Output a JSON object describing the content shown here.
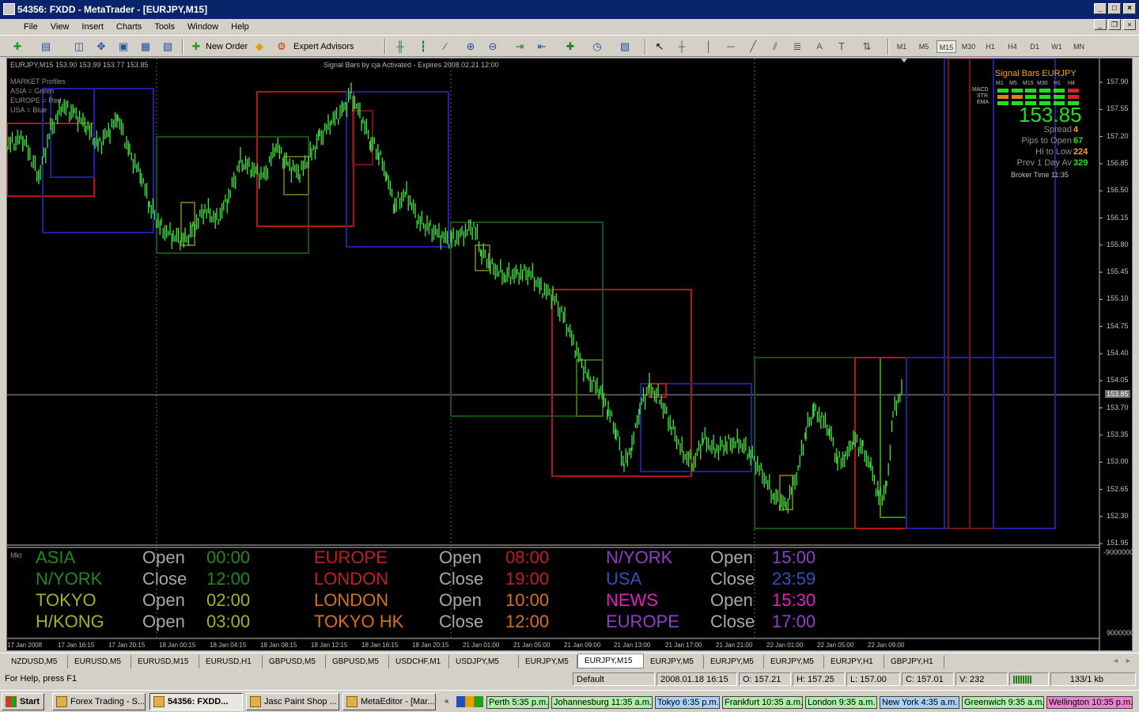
{
  "window": {
    "title": "54356: FXDD - MetaTrader - [EURJPY,M15]"
  },
  "menu": [
    "File",
    "View",
    "Insert",
    "Charts",
    "Tools",
    "Window",
    "Help"
  ],
  "toolbar": {
    "new_order": "New Order",
    "expert_advisors": "Expert Advisors",
    "timeframes": [
      "M1",
      "M5",
      "M15",
      "M30",
      "H1",
      "H4",
      "D1",
      "W1",
      "MN"
    ],
    "active_timeframe": "M15"
  },
  "chart": {
    "symbol_line": "EURJPY,M15  153.90 153.99 153.77 153.85",
    "indicator_title": "Signal Bars by cja Activated - Expires  2008.02.21 12:00",
    "market_profiles": {
      "title": "MARKET Profiles",
      "rows": [
        "ASIA        = Green",
        "EUROPE   = Red",
        "USA         = Blue"
      ]
    },
    "signal_panel": {
      "title": "Signal Bars EURJPY",
      "tf_labels": [
        "M1",
        "M5",
        "M15",
        "M30",
        "H1",
        "H4"
      ],
      "row_labels": [
        "MACD",
        "STR",
        "EMA"
      ],
      "price": "153.85",
      "stats": [
        {
          "label": "Spread",
          "value": "4",
          "color": "#ffa020"
        },
        {
          "label": "Pips to Open",
          "value": "67",
          "color": "#20e020"
        },
        {
          "label": "Hi to Low",
          "value": "224",
          "color": "#ffa020"
        },
        {
          "label": "Prev 1 Day Av",
          "value": "329",
          "color": "#20e020"
        }
      ],
      "broker_time": "Broker Time 11:35"
    },
    "price_labels": [
      "157.90",
      "157.55",
      "157.20",
      "156.85",
      "156.50",
      "156.15",
      "155.80",
      "155.45",
      "155.10",
      "154.75",
      "154.40",
      "154.05",
      "153.70",
      "153.35",
      "153.00",
      "152.65",
      "152.30",
      "151.95"
    ],
    "current_price": "153.85",
    "sub_labels": [
      "-9000000",
      "9000000"
    ],
    "sub_title": "Mkt",
    "time_labels": [
      "17 Jan 2008",
      "17 Jan 16:15",
      "17 Jan 20:15",
      "18 Jan 00:15",
      "18 Jan 04:15",
      "18 Jan 08:15",
      "18 Jan 12:15",
      "18 Jan 16:15",
      "18 Jan 20:15",
      "21 Jan 01:00",
      "21 Jan 05:00",
      "21 Jan 09:00",
      "21 Jan 13:00",
      "21 Jan 17:00",
      "21 Jan 21:00",
      "22 Jan 01:00",
      "22 Jan 05:00",
      "22 Jan 09:00"
    ],
    "sessions": [
      {
        "name": "ASIA",
        "action": "Open",
        "time": "00:00",
        "color": "#208820"
      },
      {
        "name": "N/YORK",
        "action": "Close",
        "time": "12:00",
        "color": "#208820"
      },
      {
        "name": "TOKYO",
        "action": "Open",
        "time": "02:00",
        "color": "#a8b020"
      },
      {
        "name": "H/KONG",
        "action": "Open",
        "time": "03:00",
        "color": "#a8b020"
      },
      {
        "name": "EUROPE",
        "action": "Open",
        "time": "08:00",
        "color": "#c02020"
      },
      {
        "name": "LONDON",
        "action": "Close",
        "time": "19:00",
        "color": "#c02020"
      },
      {
        "name": "LONDON",
        "action": "Open",
        "time": "10:00",
        "color": "#d87020"
      },
      {
        "name": "TOKYO HK",
        "action": "Close",
        "time": "12:00",
        "color": "#d87020"
      },
      {
        "name": "N/YORK",
        "action": "Open",
        "time": "15:00",
        "color": "#9040c8"
      },
      {
        "name": "USA",
        "action": "Close",
        "time": "23:59",
        "color": "#3050c0"
      },
      {
        "name": "NEWS",
        "action": "Open",
        "time": "15:30",
        "color": "#e020c0"
      },
      {
        "name": "EUROPE",
        "action": "Close",
        "time": "17:00",
        "color": "#9040c8"
      }
    ]
  },
  "tabs": [
    "NZDUSD,M5",
    "EURUSD,M5",
    "EURUSD,M15",
    "EURUSD,H1",
    "GBPUSD,M5",
    "GBPUSD,M5",
    "USDCHF,M1",
    "USDJPY,M5",
    "EURJPY,M5",
    "EURJPY,M15",
    "EURJPY,M5",
    "EURJPY,M5",
    "EURJPY,M5",
    "EURJPY,H1",
    "GBPJPY,H1"
  ],
  "active_tab": 9,
  "status": {
    "help": "For Help, press F1",
    "profile": "Default",
    "datetime": "2008.01.18 16:15",
    "open": "O: 157.21",
    "high": "H: 157.25",
    "low": "L: 157.00",
    "close": "C: 157.01",
    "volume": "V: 232",
    "traffic": "133/1 kb"
  },
  "taskbar": {
    "start": "Start",
    "tasks": [
      "Forex Trading - S...",
      "54356: FXDD...",
      "Jasc Paint Shop ...",
      "MetaEditor - [Mar..."
    ],
    "clocks": [
      {
        "label": "Perth 5:35 p.m.",
        "color": "#a8f0a8"
      },
      {
        "label": "Johannesburg 11:35 a.m.",
        "color": "#a8f0a8"
      },
      {
        "label": "Tokyo 6:35 p.m.",
        "color": "#a8d0f8"
      },
      {
        "label": "Frankfurt 10:35 a.m.",
        "color": "#a8f0a8"
      },
      {
        "label": "London 9:35 a.m.",
        "color": "#a8f0a8"
      },
      {
        "label": "New York 4:35 a.m.",
        "color": "#a8d0f8"
      },
      {
        "label": "Greenwich 9:35 a.m.",
        "color": "#a8f0a8"
      },
      {
        "label": "Wellington 10:35 p.m.",
        "color": "#f080d0"
      }
    ]
  }
}
